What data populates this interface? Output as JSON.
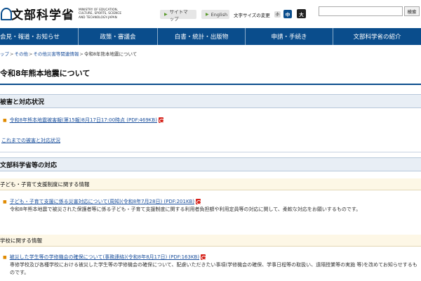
{
  "header": {
    "logo_title": "文部科学省",
    "logo_sub": "MINISTRY OF EDUCATION, CULTURE, SPORTS, SCIENCE AND TECHNOLOGY-JAPAN",
    "sitemap": "サイトマップ",
    "english": "English",
    "fontsize_label": "文字サイズの変更",
    "fs_small": "小",
    "fs_mid": "中",
    "fs_large": "大",
    "search_placeholder": "",
    "search_button": "検索"
  },
  "nav": {
    "items": [
      {
        "label": "会見・報道・お知らせ"
      },
      {
        "label": "政策・審議会"
      },
      {
        "label": "白書・統計・出版物"
      },
      {
        "label": "申請・手続き"
      },
      {
        "label": "文部科学省の紹介"
      }
    ]
  },
  "breadcrumb": {
    "items": [
      "ップ",
      "その他",
      "その他災害等関連情報"
    ],
    "current": "令和8年熊本地震について"
  },
  "page": {
    "title": "令和8年熊本地震について"
  },
  "sections": {
    "damage": {
      "heading": "被害と対応状況",
      "link1": "令和8年熊本地震被害報(第15報)8月17日17:00時点 (PDF:469KB)",
      "link2": "これまでの被害と対応状況"
    },
    "response": {
      "heading": "文部科学省等の対応",
      "sub1": {
        "heading": "子ども・子育て支援制度に関する情報",
        "link": "子ども・子育て支援に係る災害対応について(周知)(令和8年7月28日) (PDF:201KB)",
        "desc": "令和8年熊本地震で被災された保護者等に係る子ども・子育て支援制度に関する利用者負担額や利用定員等の対応に関して、柔軟な対応をお願いするものです。"
      },
      "sub2": {
        "heading": "学校に関する情報",
        "link": "被災した学生等の学修機会の確保について(事務連絡)(令和8年8月17日) (PDF:163KB)",
        "desc": "専修学校及び各種学校における被災した学生等の学修機会の確保について、配慮いただきたい事項(学修機会の確保、学事日程等の取扱い、遠隔授業等の実施 等)を改めてお知らせするものです。"
      }
    }
  }
}
